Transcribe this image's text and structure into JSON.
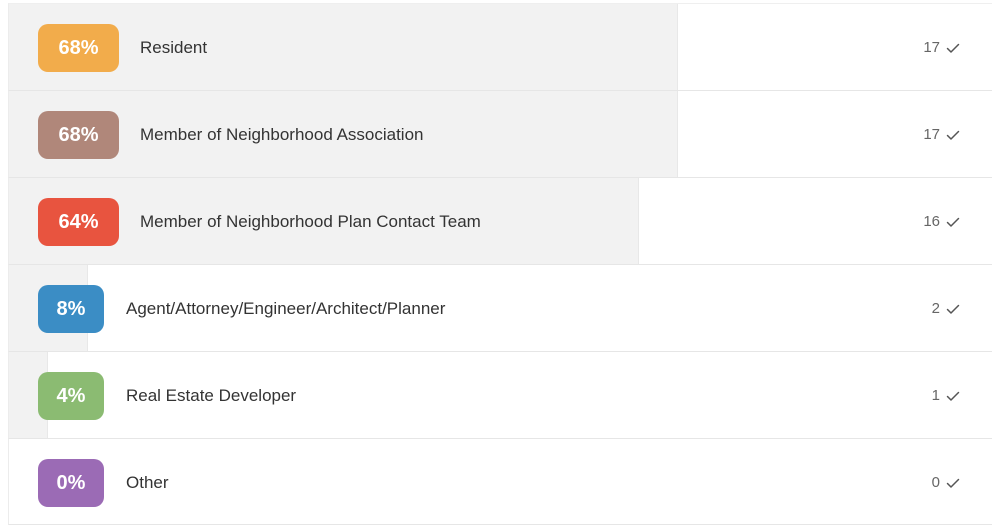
{
  "results": {
    "rows": [
      {
        "percent": "68%",
        "label": "Resident",
        "count": "17",
        "fill_fraction": 0.68,
        "color": "#F2AC4B"
      },
      {
        "percent": "68%",
        "label": "Member of Neighborhood Association",
        "count": "17",
        "fill_fraction": 0.68,
        "color": "#B0877A"
      },
      {
        "percent": "64%",
        "label": "Member of Neighborhood Plan Contact Team",
        "count": "16",
        "fill_fraction": 0.64,
        "color": "#E8543F"
      },
      {
        "percent": "8%",
        "label": "Agent/Attorney/Engineer/Architect/Planner",
        "count": "2",
        "fill_fraction": 0.08,
        "color": "#3B8DC5"
      },
      {
        "percent": "4%",
        "label": "Real Estate Developer",
        "count": "1",
        "fill_fraction": 0.04,
        "color": "#8BBB72"
      },
      {
        "percent": "0%",
        "label": "Other",
        "count": "0",
        "fill_fraction": 0.0,
        "color": "#9B6BB5"
      }
    ],
    "check_icon": "check-icon"
  }
}
